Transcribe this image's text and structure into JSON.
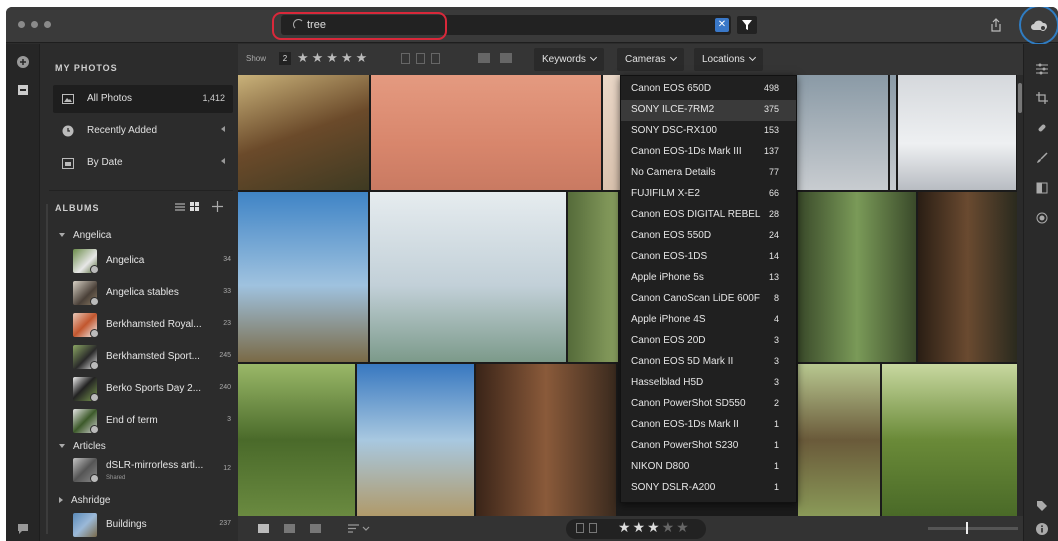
{
  "search": {
    "value": "tree"
  },
  "sidebar": {
    "my_photos_title": "MY PHOTOS",
    "items": [
      {
        "label": "All Photos",
        "count": "1,412"
      },
      {
        "label": "Recently Added"
      },
      {
        "label": "By Date"
      }
    ],
    "albums_title": "ALBUMS",
    "groups": [
      "Angelica",
      "Articles",
      "Ashridge"
    ],
    "albums": [
      {
        "label": "Angelica",
        "count": "34"
      },
      {
        "label": "Angelica stables",
        "count": "33"
      },
      {
        "label": "Berkhamsted Royal...",
        "count": "23"
      },
      {
        "label": "Berkhamsted Sport...",
        "count": "245"
      },
      {
        "label": "Berko Sports Day 2...",
        "count": "240"
      },
      {
        "label": "End of term",
        "count": "3"
      },
      {
        "label": "dSLR-mirrorless arti...",
        "sub": "Shared",
        "count": "12"
      },
      {
        "label": "Buildings",
        "count": "237"
      }
    ]
  },
  "toolbar": {
    "show_label": "Show",
    "rating_min": "2",
    "keywords": "Keywords",
    "cameras": "Cameras",
    "locations": "Locations"
  },
  "cameras_menu": [
    {
      "name": "Canon EOS 650D",
      "count": "498"
    },
    {
      "name": "SONY ILCE-7RM2",
      "count": "375"
    },
    {
      "name": "SONY DSC-RX100",
      "count": "153"
    },
    {
      "name": "Canon EOS-1Ds Mark III",
      "count": "137"
    },
    {
      "name": "No Camera Details",
      "count": "77"
    },
    {
      "name": "FUJIFILM X-E2",
      "count": "66"
    },
    {
      "name": "Canon EOS DIGITAL REBEL",
      "count": "28"
    },
    {
      "name": "Canon EOS 550D",
      "count": "24"
    },
    {
      "name": "Canon EOS-1DS",
      "count": "14"
    },
    {
      "name": "Apple iPhone 5s",
      "count": "13"
    },
    {
      "name": "Canon CanoScan LiDE 600F",
      "count": "8"
    },
    {
      "name": "Apple iPhone 4S",
      "count": "4"
    },
    {
      "name": "Canon EOS 20D",
      "count": "3"
    },
    {
      "name": "Canon EOS 5D Mark II",
      "count": "3"
    },
    {
      "name": "Hasselblad H5D",
      "count": "3"
    },
    {
      "name": "Canon PowerShot SD550",
      "count": "2"
    },
    {
      "name": "Canon EOS-1Ds Mark II",
      "count": "1"
    },
    {
      "name": "Canon PowerShot S230",
      "count": "1"
    },
    {
      "name": "NIKON D800",
      "count": "1"
    },
    {
      "name": "SONY DSLR-A200",
      "count": "1"
    }
  ],
  "bottom": {
    "rating_stars": 3
  },
  "colors": {
    "accent_blue": "#2f7cc2",
    "highlight_red": "#d9283a",
    "selected_row": "#3a3a3a"
  },
  "icons": [
    "search-spinner-icon",
    "clear-icon",
    "filter-icon",
    "share-icon",
    "cloud-sync-icon",
    "add-icon",
    "library-icon",
    "comment-icon",
    "edit-sliders-icon",
    "crop-icon",
    "healing-icon",
    "brush-icon",
    "gradient-icon",
    "radial-icon",
    "tag-icon",
    "info-icon"
  ]
}
